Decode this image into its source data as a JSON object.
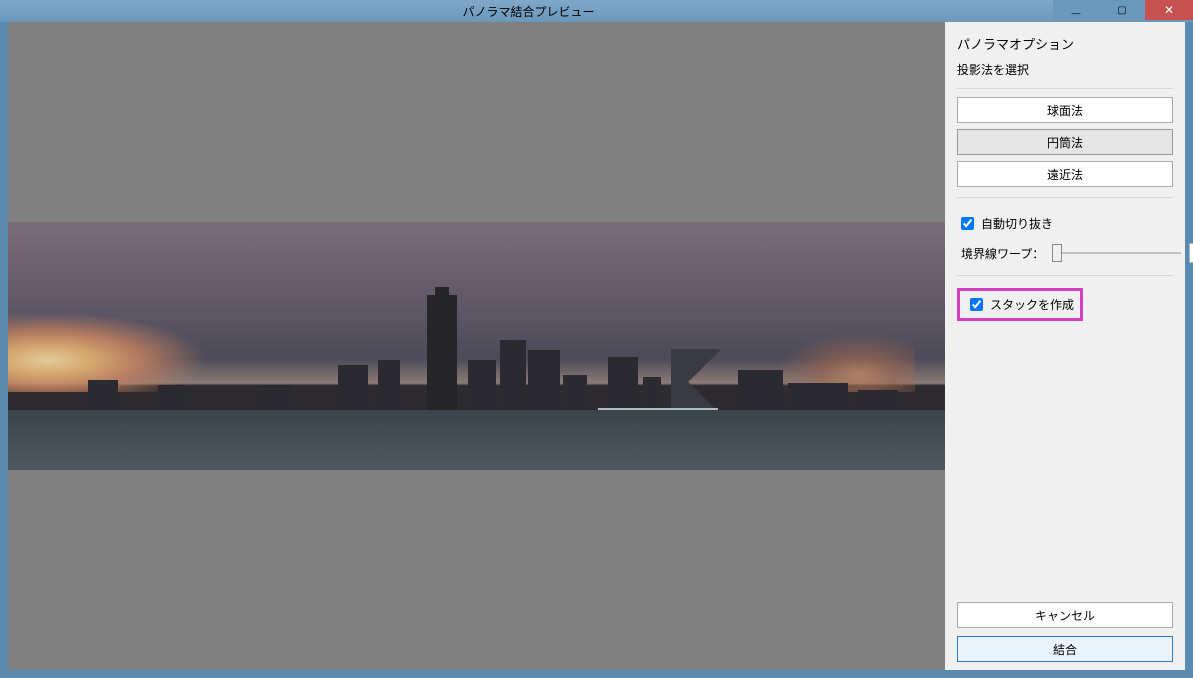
{
  "window": {
    "title": "パノラマ結合プレビュー"
  },
  "panel": {
    "title": "パノラマオプション",
    "projection_label": "投影法を選択",
    "projection": {
      "spherical": "球面法",
      "cylindrical": "円筒法",
      "perspective": "遠近法"
    },
    "auto_crop": {
      "label": "自動切り抜き",
      "checked": true
    },
    "boundary_warp": {
      "label": "境界線ワープ：",
      "value": "0"
    },
    "create_stack": {
      "label": "スタックを作成",
      "checked": true
    },
    "cancel": "キャンセル",
    "merge": "結合"
  }
}
